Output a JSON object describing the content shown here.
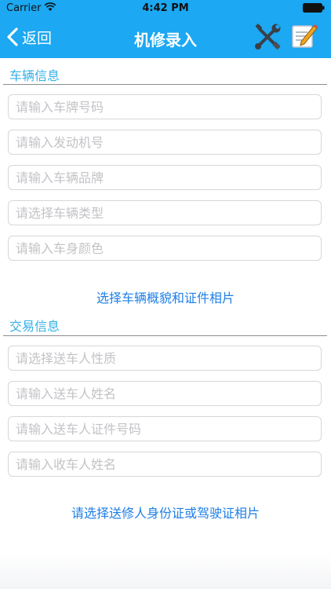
{
  "status_bar": {
    "carrier": "Carrier",
    "time": "4:42 PM"
  },
  "nav": {
    "back_label": "返回",
    "title": "机修录入",
    "tools_icon": "wrench-screwdriver-icon",
    "edit_icon": "edit-note-icon"
  },
  "vehicle_section": {
    "title": "车辆信息",
    "fields": [
      {
        "placeholder": "请输入车牌号码"
      },
      {
        "placeholder": "请输入发动机号"
      },
      {
        "placeholder": "请输入车辆品牌"
      },
      {
        "placeholder": "请选择车辆类型"
      },
      {
        "placeholder": "请输入车身颜色"
      }
    ],
    "photo_link": "选择车辆概貌和证件相片"
  },
  "trade_section": {
    "title": "交易信息",
    "fields": [
      {
        "placeholder": "请选择送车人性质"
      },
      {
        "placeholder": "请输入送车人姓名"
      },
      {
        "placeholder": "请输入送车人证件号码"
      },
      {
        "placeholder": "请输入收车人姓名"
      }
    ],
    "photo_link": "请选择送修人身份证或驾驶证相片"
  },
  "colors": {
    "nav_bar": "#1ca8f2",
    "section_title": "#35b1e6",
    "link": "#1e7fe6"
  }
}
